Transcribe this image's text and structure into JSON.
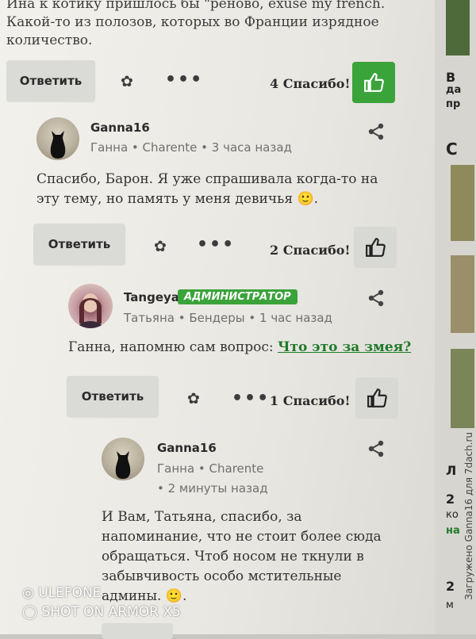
{
  "top_text": "Ина к котику пришлось бы \"реново, exuse my french. Какой-то из полозов, которых во Франции изрядное количество.",
  "reply_label": "Ответить",
  "posts": [
    {
      "thanks": "4 Спасибо!"
    },
    {
      "user": "Ganna16",
      "meta": "Ганна • Charente • 3 часа назад",
      "text": "Спасибо, Барон. Я уже спрашивала когда-то на эту тему, но память у меня девичья 🙂.",
      "thanks": "2 Спасибо!"
    },
    {
      "user": "Tangeya",
      "badge": "АДМИНИСТРАТОР",
      "meta": "Татьяна • Бендеры • 1 час назад",
      "text_prefix": "Ганна, напомню сам вопрос: ",
      "link": "Что это за змея?",
      "thanks": "1 Спасибо!"
    },
    {
      "user": "Ganna16",
      "meta_line1": "Ганна • Charente",
      "meta_line2": "• 2 минуты назад",
      "text": "И Вам, Татьяна, спасибо, за напоминание, что не стоит более сюда обращаться. Чтоб носом не ткнули в забывчивость особо мстительные админы. 🙂."
    }
  ],
  "right_column": {
    "items": [
      "В",
      "да",
      "пр",
      "С",
      "Л",
      "2",
      "ко",
      "на",
      "2",
      "м"
    ]
  },
  "watermark": "Загружено Ganna16 для 7dach.ru",
  "phone_brand": {
    "line1": "ULEFONE",
    "line2": "SHOT ON ARMOR X5"
  }
}
